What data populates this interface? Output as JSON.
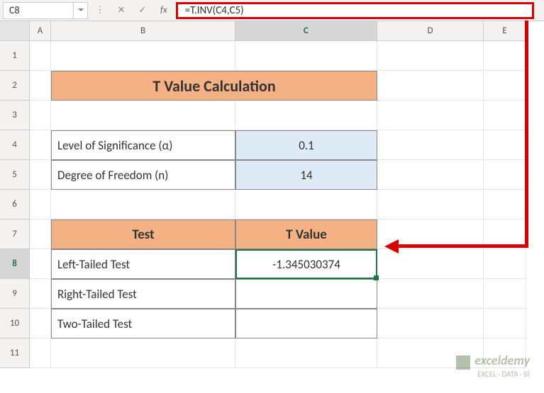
{
  "name_box": "C8",
  "formula": "=T.INV(C4,C5)",
  "columns": [
    "A",
    "B",
    "C",
    "D",
    "E"
  ],
  "rows": [
    "1",
    "2",
    "3",
    "4",
    "5",
    "6",
    "7",
    "8",
    "9",
    "10",
    "11"
  ],
  "active_col": "C",
  "active_row": "8",
  "content": {
    "title": "T Value Calculation",
    "param1_label": "Level of Significance (α)",
    "param1_value": "0.1",
    "param2_label": "Degree of Freedom (n)",
    "param2_value": "14",
    "test_header": "Test",
    "tvalue_header": "T Value",
    "test1": "Left-Tailed Test",
    "test1_val": "-1.345030374",
    "test2": "Right-Tailed Test",
    "test2_val": "",
    "test3": "Two-Tailed Test",
    "test3_val": ""
  },
  "watermark": {
    "title": "exceldemy",
    "subtitle": "EXCEL · DATA · BI"
  },
  "chart_data": {
    "type": "table",
    "title": "T Value Calculation",
    "parameters": {
      "alpha": 0.1,
      "degrees_of_freedom": 14
    },
    "results": [
      {
        "test": "Left-Tailed Test",
        "t_value": -1.345030374
      },
      {
        "test": "Right-Tailed Test",
        "t_value": null
      },
      {
        "test": "Two-Tailed Test",
        "t_value": null
      }
    ]
  }
}
